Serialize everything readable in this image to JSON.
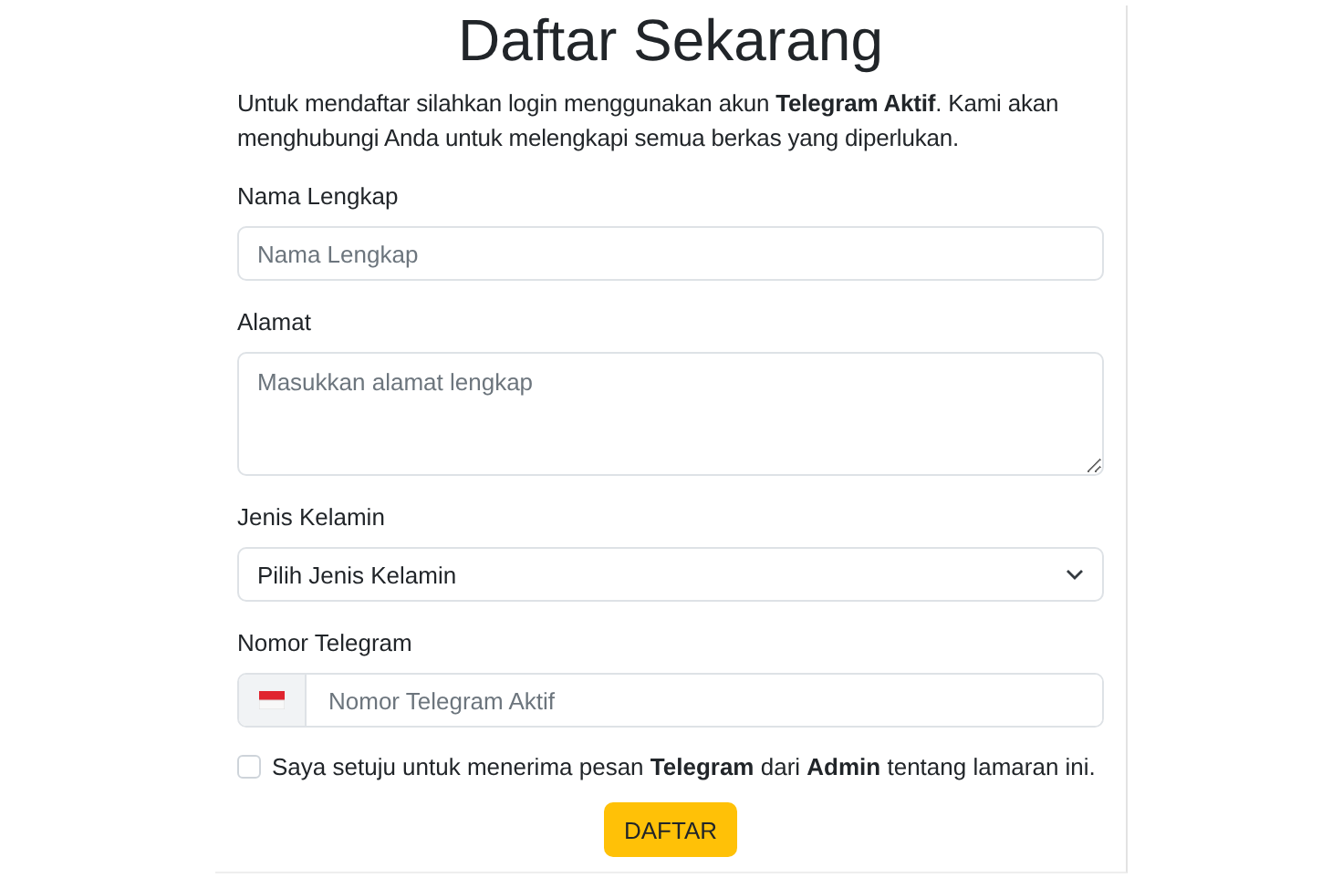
{
  "title": "Daftar Sekarang",
  "intro": "Untuk mendaftar silahkan login menggunakan akun **Telegram Aktif**. Kami akan menghubungi Anda untuk melengkapi semua berkas yang diperlukan.",
  "fields": [
    {
      "kind": "text",
      "label": "Nama Lengkap",
      "placeholder": "Nama Lengkap"
    },
    {
      "kind": "textarea",
      "label": "Alamat",
      "placeholder": "Masukkan alamat lengkap"
    },
    {
      "kind": "select",
      "label": "Jenis Kelamin",
      "value": "Pilih Jenis Kelamin"
    },
    {
      "kind": "phone",
      "label": "Nomor Telegram",
      "placeholder": "Nomor Telegram Aktif"
    }
  ],
  "consent": {
    "text": "Saya setuju untuk menerima pesan **Telegram** dari **Admin** tentang lamaran ini.",
    "checked": false
  },
  "submit_button": "DAFTAR"
}
